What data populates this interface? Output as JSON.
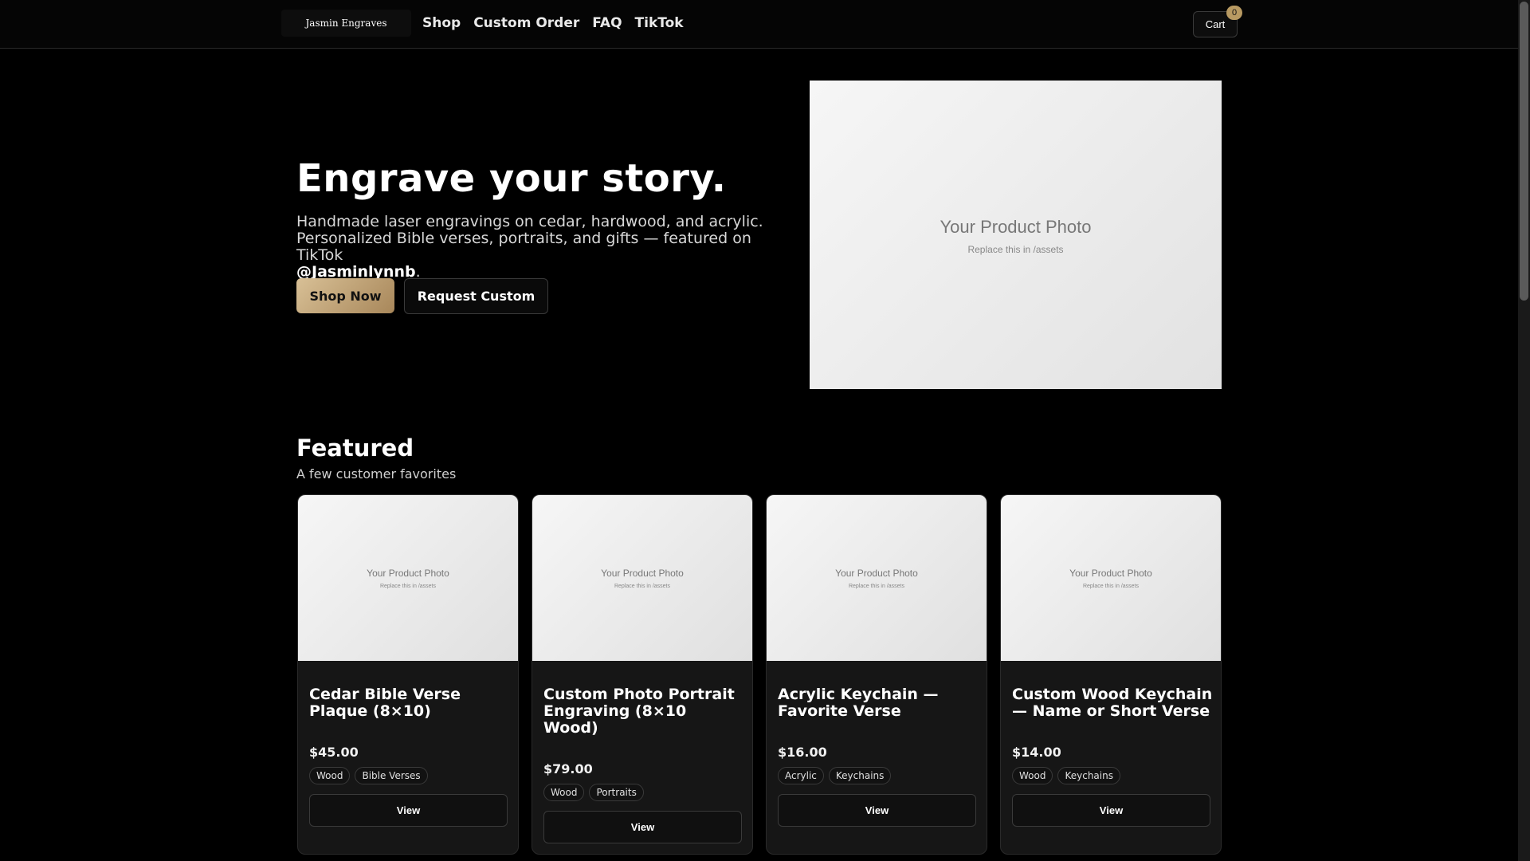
{
  "header": {
    "logo_text": "Jasmin Engraves",
    "nav": [
      "Shop",
      "Custom Order",
      "FAQ",
      "TikTok"
    ],
    "cart_label": "Cart",
    "cart_count": "0"
  },
  "hero": {
    "title": "Engrave your story.",
    "text_line1": "Handmade laser engravings on cedar, hardwood, and acrylic.",
    "text_line2": "Personalized Bible verses, portraits, and gifts — featured on TikTok",
    "handle": "@Jasminlynnb",
    "handle_suffix": ".",
    "shop_button": "Shop Now",
    "custom_button": "Request Custom",
    "photo_title": "Your Product Photo",
    "photo_sub": "Replace this in /assets"
  },
  "featured": {
    "title": "Featured",
    "subtitle": "A few customer favorites",
    "cards": [
      {
        "photo_title": "Your Product Photo",
        "photo_sub": "Replace this in /assets",
        "name": "Cedar Bible Verse Plaque (8×10)",
        "price": "$45.00",
        "tags": [
          "Wood",
          "Bible Verses"
        ],
        "view_label": "View"
      },
      {
        "photo_title": "Your Product Photo",
        "photo_sub": "Replace this in /assets",
        "name": "Custom Photo Portrait Engraving (8×10 Wood)",
        "price": "$79.00",
        "tags": [
          "Wood",
          "Portraits"
        ],
        "view_label": "View"
      },
      {
        "photo_title": "Your Product Photo",
        "photo_sub": "Replace this in /assets",
        "name": "Acrylic Keychain — Favorite Verse",
        "price": "$16.00",
        "tags": [
          "Acrylic",
          "Keychains"
        ],
        "view_label": "View"
      },
      {
        "photo_title": "Your Product Photo",
        "photo_sub": "Replace this in /assets",
        "name": "Custom Wood Keychain — Name or Short Verse",
        "price": "$14.00",
        "tags": [
          "Wood",
          "Keychains"
        ],
        "view_label": "View"
      }
    ]
  },
  "colors": {
    "background": "#000000",
    "accent_gold": "#b89a62"
  }
}
